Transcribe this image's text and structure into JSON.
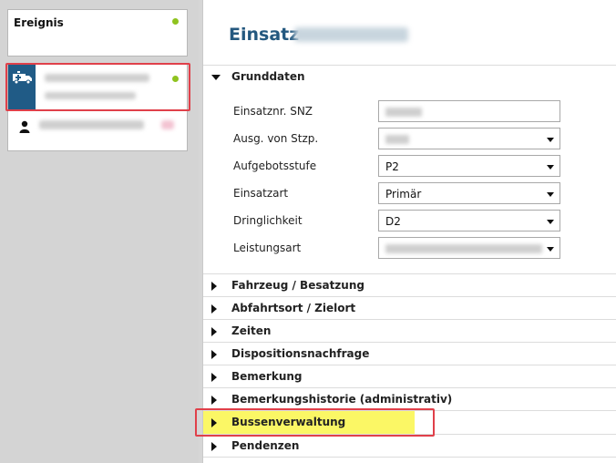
{
  "sidebar": {
    "ereignis_title": "Ereignis"
  },
  "main": {
    "title": "Einsatz",
    "sections": {
      "grunddaten": "Grunddaten",
      "fahrzeug": "Fahrzeug / Besatzung",
      "abfahrtsort": "Abfahrtsort / Zielort",
      "zeiten": "Zeiten",
      "disposition": "Dispositionsnachfrage",
      "bemerkung": "Bemerkung",
      "bemerkungshistorie": "Bemerkungshistorie (administrativ)",
      "bussenverwaltung": "Bussenverwaltung",
      "pendenzen": "Pendenzen"
    },
    "form": {
      "einsatznr_label": "Einsatznr. SNZ",
      "ausg_label": "Ausg. von Stzp.",
      "aufgebotsstufe_label": "Aufgebotsstufe",
      "aufgebotsstufe_value": "P2",
      "einsatzart_label": "Einsatzart",
      "einsatzart_value": "Primär",
      "dringlichkeit_label": "Dringlichkeit",
      "dringlichkeit_value": "D2",
      "leistungsart_label": "Leistungsart"
    }
  },
  "colors": {
    "accent": "#24587f",
    "status_dot": "#8fc31f",
    "highlight_border": "#e0404a",
    "highlight_fill": "#fbf765"
  }
}
